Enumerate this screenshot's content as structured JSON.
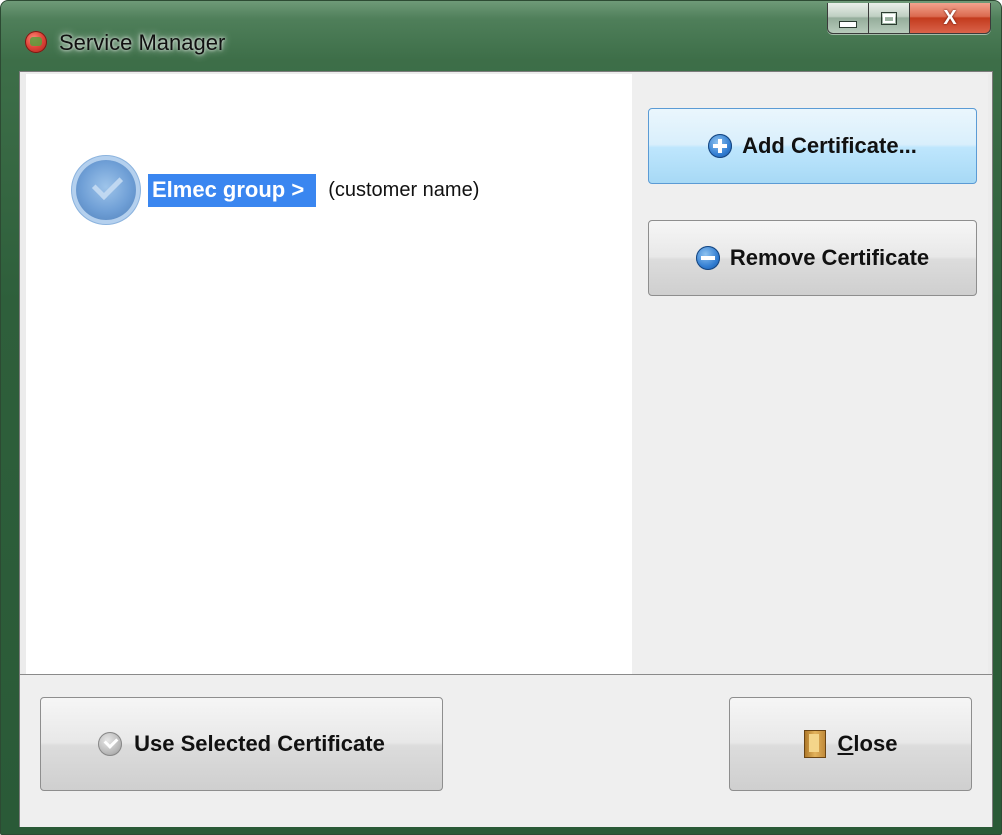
{
  "window": {
    "title": "Service Manager",
    "close_glyph": "X",
    "app_icon": "service-manager-app-icon"
  },
  "certificates": {
    "items": [
      {
        "name": "Elmec group >",
        "description": "(customer name)",
        "icon": "certificate-badge-icon",
        "selected": true
      }
    ],
    "selection_color": "#3a86f0"
  },
  "actions": {
    "add_label": "Add Certificate...",
    "remove_label": "Remove Certificate",
    "use_label": "Use Selected Certificate",
    "close_label_prefix": "",
    "close_label_accesskey": "C",
    "close_label_rest": "lose"
  }
}
